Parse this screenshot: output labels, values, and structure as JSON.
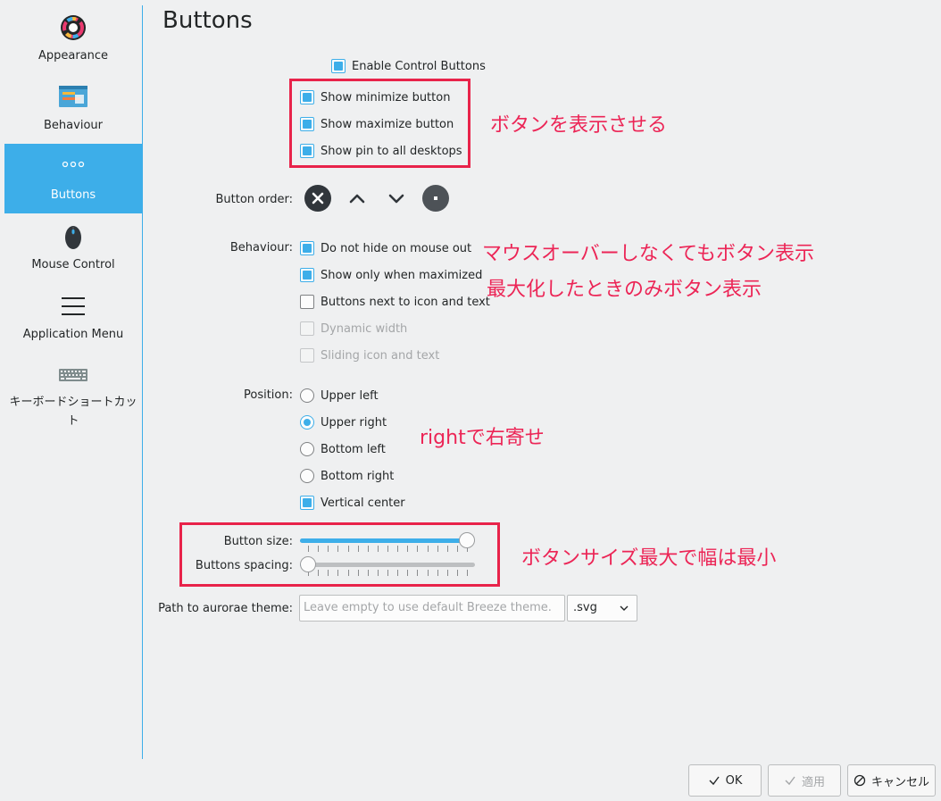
{
  "sidebar": {
    "items": [
      {
        "label": "Appearance",
        "icon": "appearance-icon"
      },
      {
        "label": "Behaviour",
        "icon": "behaviour-icon"
      },
      {
        "label": "Buttons",
        "icon": "buttons-dots-icon"
      },
      {
        "label": "Mouse Control",
        "icon": "mouse-icon"
      },
      {
        "label": "Application Menu",
        "icon": "hamburger-menu-icon"
      },
      {
        "label": "キーボードショートカット",
        "icon": "keyboard-icon"
      }
    ],
    "active": "Buttons"
  },
  "page": {
    "title": "Buttons",
    "enable_control_buttons": {
      "label": "Enable Control Buttons",
      "checked": true
    },
    "show_buttons": [
      {
        "label": "Show minimize button",
        "checked": true
      },
      {
        "label": "Show maximize button",
        "checked": true
      },
      {
        "label": "Show pin to all desktops",
        "checked": true
      }
    ],
    "button_order": {
      "label": "Button order:",
      "icons": [
        "close-icon",
        "chevron-up-icon",
        "chevron-down-icon",
        "pin-dot-icon"
      ]
    },
    "behaviour": {
      "label": "Behaviour:",
      "options": [
        {
          "label": "Do not hide on mouse out",
          "checked": true,
          "enabled": true
        },
        {
          "label": "Show only when maximized",
          "checked": true,
          "enabled": true
        },
        {
          "label": "Buttons next to icon and text",
          "checked": false,
          "enabled": true
        },
        {
          "label": "Dynamic width",
          "checked": false,
          "enabled": false
        },
        {
          "label": "Sliding icon and text",
          "checked": false,
          "enabled": false
        }
      ]
    },
    "position": {
      "label": "Position:",
      "options": [
        {
          "label": "Upper left",
          "selected": false
        },
        {
          "label": "Upper right",
          "selected": true
        },
        {
          "label": "Bottom left",
          "selected": false
        },
        {
          "label": "Bottom right",
          "selected": false
        }
      ],
      "vertical_center": {
        "label": "Vertical center",
        "checked": true
      }
    },
    "button_size": {
      "label": "Button size:",
      "value_fraction": 1.0
    },
    "buttons_spacing": {
      "label": "Buttons spacing:",
      "value_fraction": 0.0
    },
    "aurorae_theme": {
      "label": "Path to aurorae theme:",
      "placeholder": "Leave empty to use default Breeze theme.",
      "extension": ".svg"
    }
  },
  "annotations": {
    "show_buttons": "ボタンを表示させる",
    "mouse_out": "マウスオーバーしなくてもボタン表示",
    "maximized": "最大化したときのみボタン表示",
    "position": "rightで右寄せ",
    "size": "ボタンサイズ最大で幅は最小",
    "color": "#e8234a"
  },
  "dialog": {
    "ok": "OK",
    "apply": "適用",
    "cancel": "キャンセル"
  },
  "colors": {
    "accent": "#3daee9",
    "background": "#eff0f1"
  }
}
